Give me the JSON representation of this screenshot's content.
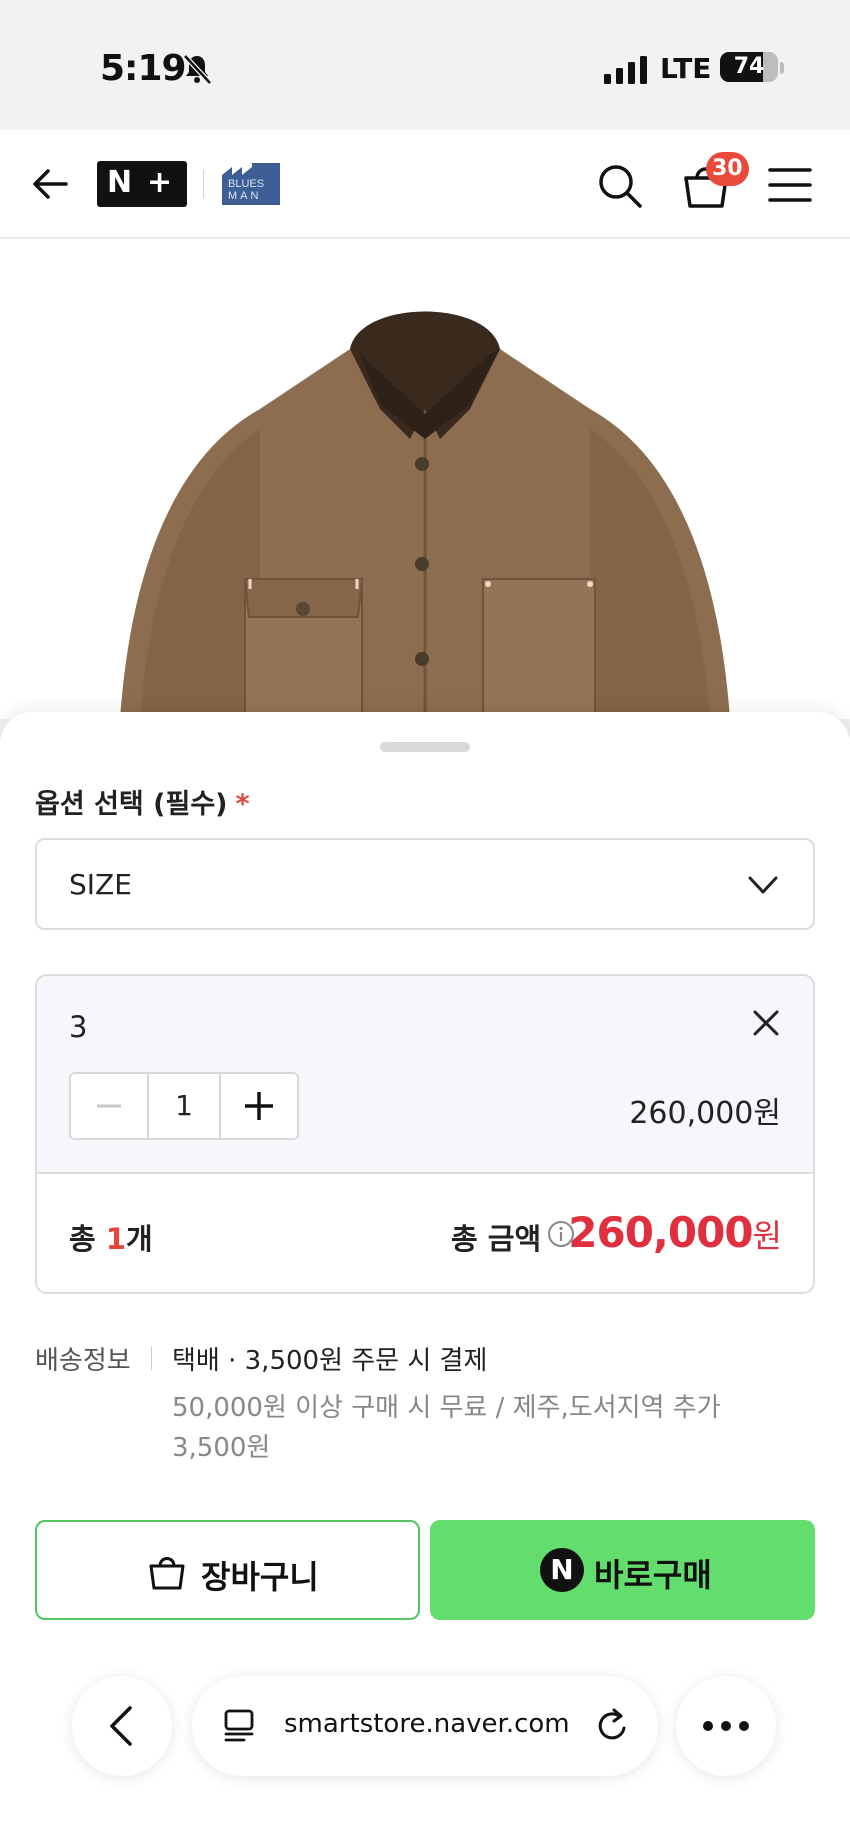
{
  "status_bar": {
    "time": "5:19",
    "network": "LTE",
    "battery": "74",
    "battery_level": 0.74
  },
  "header": {
    "logo_text_n": "N",
    "logo_text_plus": "+",
    "brand_logo_line1": "BLUES",
    "brand_logo_line2": "MAN",
    "cart_count": "30",
    "icons": [
      "back-arrow-icon",
      "search-icon",
      "cart-icon",
      "hamburger-menu-icon"
    ]
  },
  "product": {
    "image_description_icon": "jacket-image"
  },
  "options": {
    "title": "옵션 선택 (필수)",
    "required_mark": "*",
    "select_label": "SIZE",
    "selected_item": {
      "name": "3",
      "quantity": "1",
      "price": "260,000원"
    },
    "total": {
      "count_prefix": "총 ",
      "count_number": "1",
      "count_suffix": "개",
      "amount_label": "총 금액",
      "amount_value": "260,000",
      "amount_unit": "원"
    }
  },
  "shipping": {
    "label": "배송정보",
    "main": "택배 · 3,500원 주문 시 결제",
    "sub": "50,000원 이상 구매 시 무료 / 제주,도서지역 추가 3,500원"
  },
  "actions": {
    "cart_label": "장바구니",
    "buy_icon_text": "N",
    "buy_label": "바로구매"
  },
  "browser": {
    "url": "smartstore.naver.com"
  },
  "colors": {
    "accent_green": "#63dd6d",
    "cart_border_green": "#4fc65e",
    "price_red": "#e03040",
    "badge_red": "#ea4a3a"
  }
}
